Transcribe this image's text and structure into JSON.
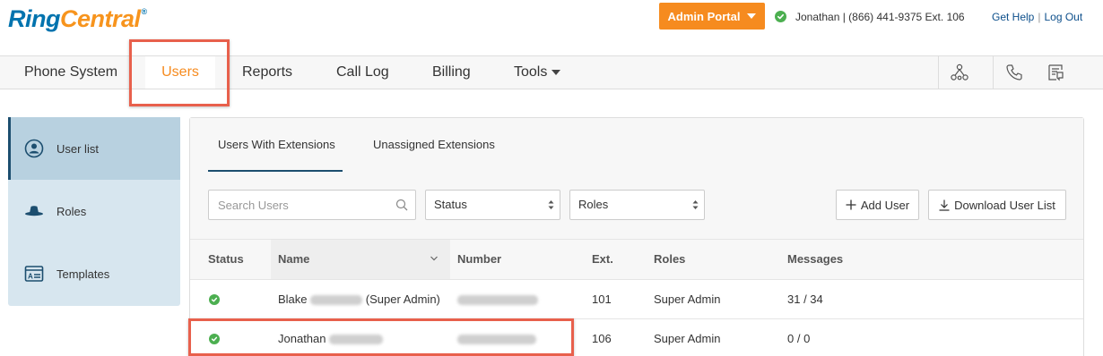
{
  "header": {
    "logo_ring": "Ring",
    "logo_central": "Central",
    "logo_mark": "®",
    "admin_portal_label": "Admin Portal",
    "user_info": "Jonathan | (866) 441-9375 Ext. 106",
    "get_help": "Get Help",
    "separator": "|",
    "log_out": "Log Out"
  },
  "topnav": {
    "items": [
      {
        "label": "Phone System"
      },
      {
        "label": "Users"
      },
      {
        "label": "Reports"
      },
      {
        "label": "Call Log"
      },
      {
        "label": "Billing"
      },
      {
        "label": "Tools"
      }
    ],
    "active": "Users",
    "icons": [
      "org-chart-icon",
      "phone-icon",
      "fax-icon"
    ]
  },
  "sidebar": {
    "items": [
      {
        "label": "User list",
        "icon": "user-circle-icon",
        "active": true
      },
      {
        "label": "Roles",
        "icon": "hat-icon",
        "active": false
      },
      {
        "label": "Templates",
        "icon": "template-icon",
        "active": false
      }
    ]
  },
  "main": {
    "tabs": [
      {
        "label": "Users With Extensions",
        "active": true
      },
      {
        "label": "Unassigned Extensions",
        "active": false
      }
    ],
    "search": {
      "placeholder": "Search Users",
      "value": ""
    },
    "filters": {
      "status": "Status",
      "roles": "Roles"
    },
    "buttons": {
      "add_user": "Add User",
      "download_user_list": "Download User List"
    },
    "table": {
      "columns": [
        "Status",
        "Name",
        "Number",
        "Ext.",
        "Roles",
        "Messages"
      ],
      "rows": [
        {
          "first_name": "Blake",
          "suffix": "(Super Admin)",
          "ext": "101",
          "role": "Super Admin",
          "messages": "31 / 34"
        },
        {
          "first_name": "Jonathan",
          "suffix": "",
          "ext": "106",
          "role": "Super Admin",
          "messages": "0 / 0"
        }
      ]
    }
  },
  "colors": {
    "brand_blue": "#0073ae",
    "brand_orange": "#f68b1f",
    "active_nav": "#f68b1f",
    "status_ok": "#4caf50",
    "highlight_box": "#e8604c",
    "sidebar_bg": "#d7e6ef"
  }
}
